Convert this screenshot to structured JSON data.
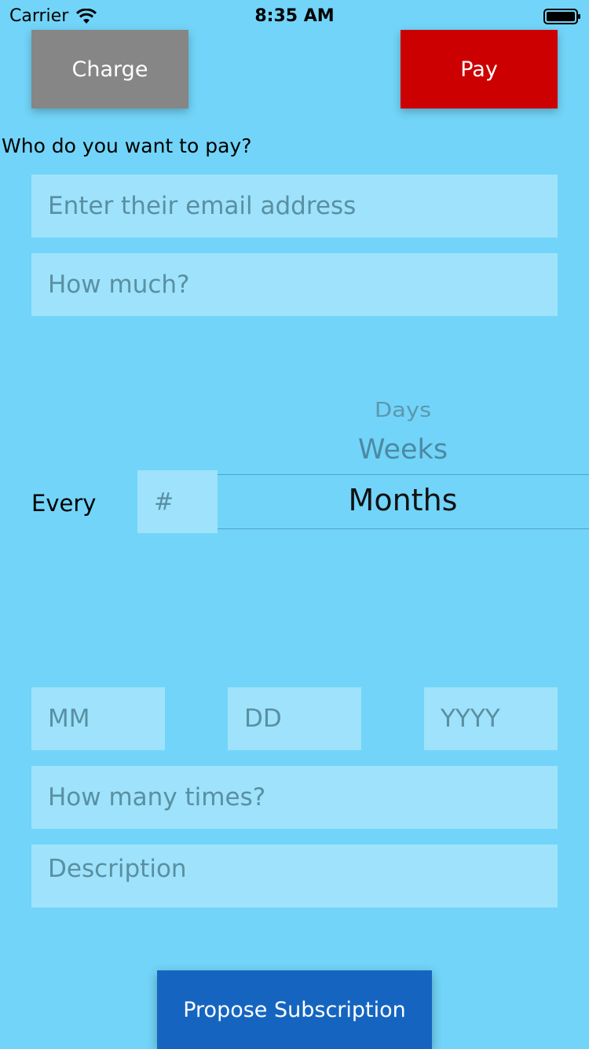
{
  "status_bar": {
    "carrier": "Carrier",
    "time": "8:35 AM"
  },
  "toolbar": {
    "charge_label": "Charge",
    "pay_label": "Pay",
    "pay_color": "#cc0000",
    "charge_color": "#868686"
  },
  "form": {
    "question": "Who do you want to pay?",
    "email_placeholder": "Enter their email address",
    "amount_placeholder": "How much?",
    "every_label": "Every",
    "number_placeholder": "#",
    "interval_picker": {
      "options": [
        "Days",
        "Weeks",
        "Months"
      ],
      "selected": "Months"
    },
    "month_placeholder": "MM",
    "day_placeholder": "DD",
    "year_placeholder": "YYYY",
    "times_placeholder": "How many times?",
    "description_placeholder": "Description"
  },
  "actions": {
    "propose_label": "Propose Subscription",
    "propose_color": "#1565c0"
  },
  "colors": {
    "background": "#72d4f8",
    "field_background": "#9ee3fb"
  }
}
